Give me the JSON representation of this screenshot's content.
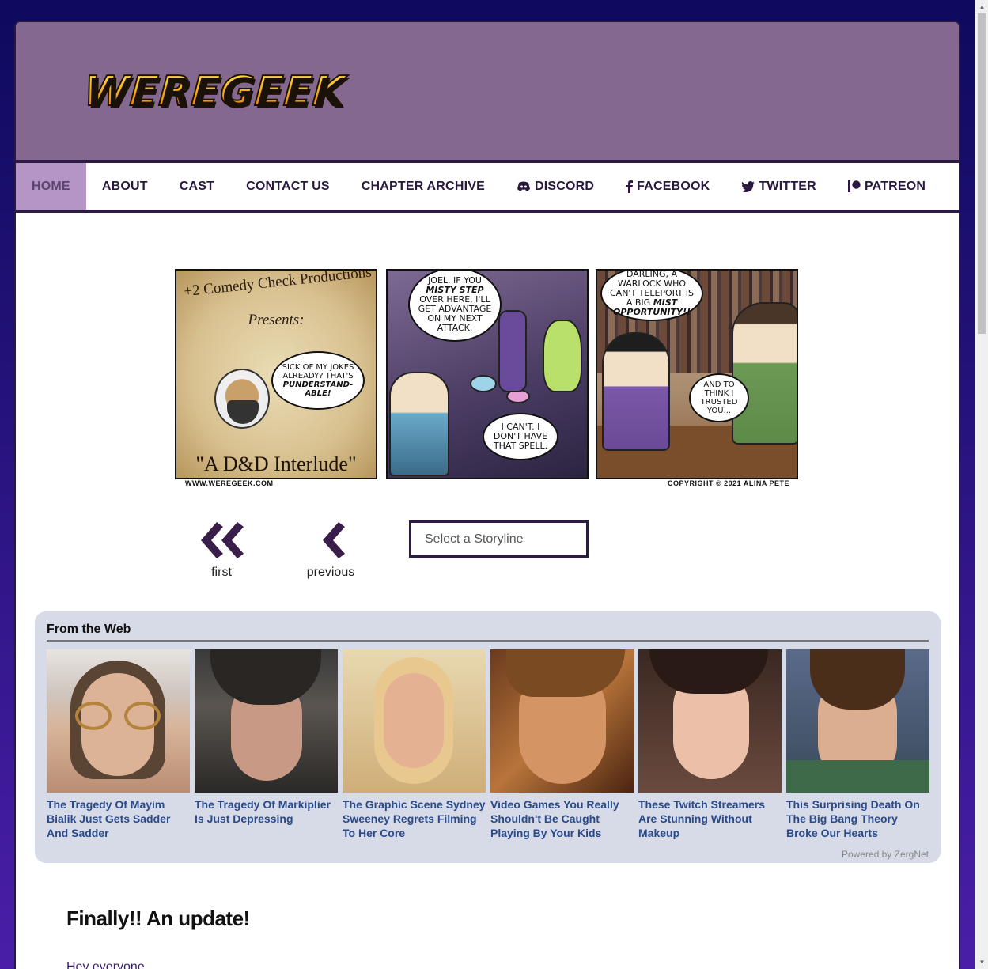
{
  "site": {
    "logo_text": "WEREGEEK"
  },
  "nav": {
    "items": [
      {
        "label": "HOME",
        "icon": "",
        "active": true
      },
      {
        "label": "ABOUT",
        "icon": ""
      },
      {
        "label": "CAST",
        "icon": ""
      },
      {
        "label": "CONTACT US",
        "icon": ""
      },
      {
        "label": "CHAPTER ARCHIVE",
        "icon": ""
      },
      {
        "label": "DISCORD",
        "icon": "discord-icon"
      },
      {
        "label": "FACEBOOK",
        "icon": "facebook-icon"
      },
      {
        "label": "TWITTER",
        "icon": "twitter-icon"
      },
      {
        "label": "PATREON",
        "icon": "patreon-icon"
      }
    ]
  },
  "comic": {
    "panel1": {
      "arc_text": "+2 Comedy Check Productions",
      "presents": "Presents:",
      "bubble": "Sick of my jokes already? That's",
      "bubble_emph": "punderstand-able!",
      "title": "\"A D&D Interlude\""
    },
    "panel2": {
      "bubble1_a": "Joel, if you",
      "bubble1_emph": "misty step",
      "bubble1_b": "over here, I'll get advantage on my next attack.",
      "bubble2": "I can't. I don't have that spell."
    },
    "panel3": {
      "bubble1_a": "Darling, a warlock who can't teleport is a big",
      "bubble1_emph": "mist opportunity!!",
      "bubble2": "And to think I trusted you..."
    },
    "credit_left": "WWW.WEREGEEK.COM",
    "credit_right": "COPYRIGHT © 2021 ALINA PETE"
  },
  "comic_nav": {
    "first_label": "first",
    "previous_label": "previous",
    "storyline_placeholder": "Select a Storyline"
  },
  "from_web": {
    "title": "From the Web",
    "powered": "Powered by ZergNet",
    "cards": [
      {
        "caption": "The Tragedy Of Mayim Bialik Just Gets Sadder And Sadder"
      },
      {
        "caption": "The Tragedy Of Markiplier Is Just Depressing"
      },
      {
        "caption": "The Graphic Scene Sydney Sweeney Regrets Filming To Her Core"
      },
      {
        "caption": "Video Games You Really Shouldn't Be Caught Playing By Your Kids"
      },
      {
        "caption": "These Twitch Streamers Are Stunning Without Makeup"
      },
      {
        "caption": "This Surprising Death On The Big Bang Theory Broke Our Hearts"
      }
    ]
  },
  "post": {
    "title": "Finally!! An update!",
    "first_line": "Hey everyone,"
  }
}
